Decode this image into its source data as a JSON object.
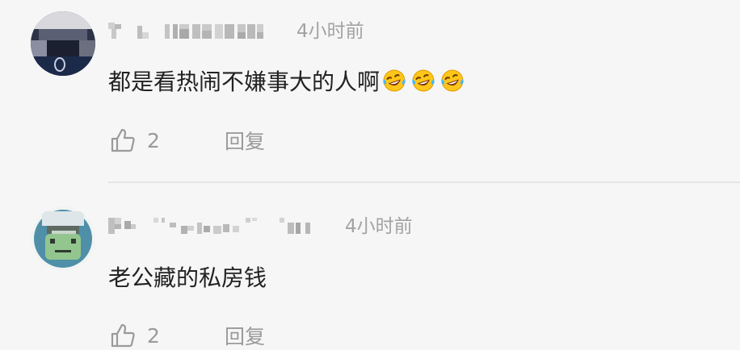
{
  "comments": [
    {
      "time": "4小时前",
      "text": "都是看热闹不嫌事大的人啊",
      "emojis": [
        "laugh-cry-emoji",
        "laugh-cry-emoji",
        "laugh-cry-emoji"
      ],
      "likes": "2",
      "reply_label": "回复"
    },
    {
      "time": "4小时前",
      "text": "老公藏的私房钱",
      "likes": "2",
      "reply_label": "回复"
    }
  ],
  "colors": {
    "background": "#f6f6f6",
    "text": "#222222",
    "meta": "#a3a3a3",
    "divider": "#e6e6e6"
  }
}
